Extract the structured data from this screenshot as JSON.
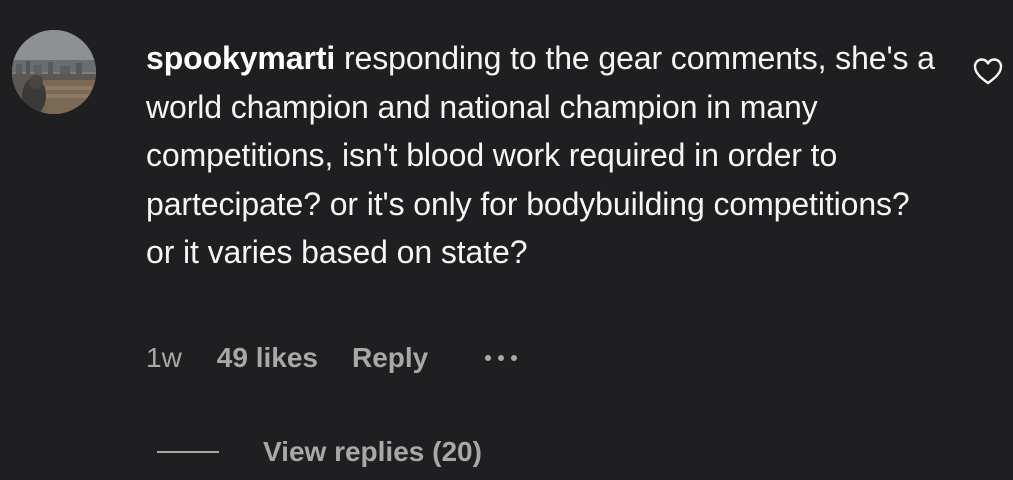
{
  "comment": {
    "username": "spookymarti",
    "text": "responding to the gear comments, she's a world champion and national champion in many competitions, isn't blood work required in order to partecipate? or it's only for bodybuilding competitions? or it varies based on state?",
    "time": "1w",
    "likes": "49 likes",
    "reply_label": "Reply",
    "like_icon": "heart-outline-icon",
    "more_icon": "more-horizontal-icon"
  },
  "replies": {
    "view_label": "View replies (20)"
  },
  "colors": {
    "background": "#1f1f22",
    "text": "#f5f5f5",
    "secondary": "#a8a8a8"
  }
}
